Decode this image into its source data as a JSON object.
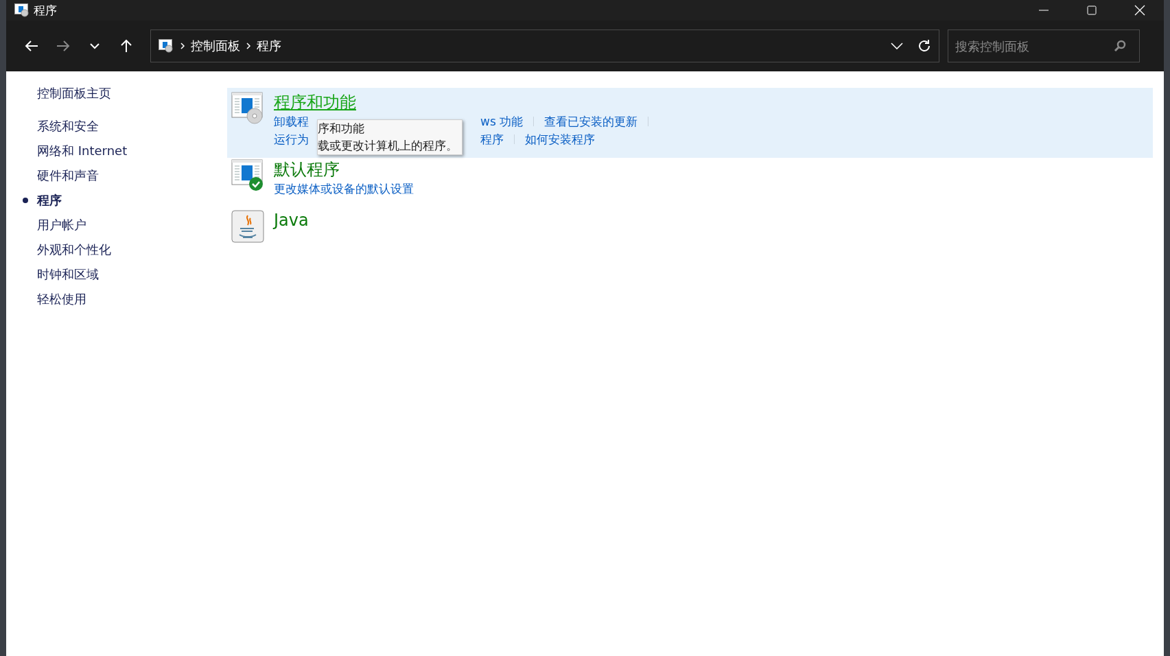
{
  "window": {
    "title": "程序"
  },
  "address_bar": {
    "path": [
      "控制面板",
      "程序"
    ]
  },
  "search": {
    "placeholder": "搜索控制面板"
  },
  "sidebar": {
    "home": "控制面板主页",
    "items": [
      {
        "label": "系统和安全",
        "selected": false
      },
      {
        "label": "网络和 Internet",
        "selected": false
      },
      {
        "label": "硬件和声音",
        "selected": false
      },
      {
        "label": "程序",
        "selected": true
      },
      {
        "label": "用户帐户",
        "selected": false
      },
      {
        "label": "外观和个性化",
        "selected": false
      },
      {
        "label": "时钟和区域",
        "selected": false
      },
      {
        "label": "轻松使用",
        "selected": false
      }
    ]
  },
  "categories": [
    {
      "kind": "programs",
      "title": "程序和功能",
      "hovered": true,
      "link_rows": [
        [
          {
            "text": "卸载程",
            "covered_after": true
          },
          {
            "text": "ws 功能",
            "covered_after": false
          },
          {
            "text": "查看已安装的更新",
            "covered_after": false
          }
        ],
        [
          {
            "text": "运行为",
            "covered_after": true
          },
          {
            "text": "程序",
            "covered_after": false
          },
          {
            "text": "如何安装程序",
            "covered_after": false
          }
        ]
      ]
    },
    {
      "kind": "defaults",
      "title": "默认程序",
      "hovered": false,
      "link_rows": [
        [
          {
            "text": "更改媒体或设备的默认设置",
            "covered_after": false
          }
        ]
      ]
    },
    {
      "kind": "java",
      "title": "Java",
      "hovered": false
    }
  ],
  "tooltip": {
    "lines": [
      "序和功能",
      "载或更改计算机上的程序。"
    ]
  }
}
